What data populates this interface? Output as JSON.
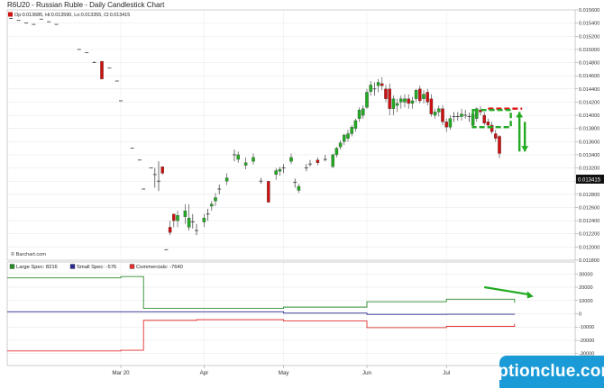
{
  "page_title": "R6U20 - Russian Ruble - Daily Candlestick Chart",
  "ohlc_label": "Op:0.013685, Hi:0.013590, Lo:0.013355, Cl:0.013415",
  "credit": "© Barchart.com",
  "last_price": "0.013415",
  "watermark": "optionclue.com",
  "colors": {
    "up": "#22aa22",
    "down": "#cc1111",
    "large_spec": "#2a8a2a",
    "small_spec": "#2a2a90",
    "commercials": "#e03030",
    "resistance": "#e01010",
    "box": "#22aa22",
    "price_box": "#111111"
  },
  "chart_data": [
    {
      "type": "candlestick",
      "title": "R6U20 - Russian Ruble - Daily Candlestick Chart",
      "ylim": [
        0.0118,
        0.0156
      ],
      "yticks": [
        "0.015600",
        "0.015400",
        "0.015200",
        "0.015000",
        "0.014800",
        "0.014600",
        "0.014400",
        "0.014200",
        "0.014000",
        "0.013800",
        "0.013600",
        "0.013400",
        "0.013200",
        "0.013000",
        "0.012800",
        "0.012600",
        "0.012400",
        "0.012200",
        "0.012000",
        "0.011800"
      ],
      "xticks": [
        "Mar 20",
        "Apr",
        "May",
        "Jun",
        "Jul"
      ],
      "xtick_days": [
        30,
        52,
        73,
        95,
        116
      ],
      "xlim_days": [
        0,
        150
      ],
      "candles": [
        [
          1,
          0.01547,
          0.01547,
          0.01547,
          0.01547
        ],
        [
          3,
          0.01544,
          0.01544,
          0.01544,
          0.01544
        ],
        [
          5,
          0.0154,
          0.0154,
          0.0154,
          0.0154
        ],
        [
          7,
          0.01538,
          0.01538,
          0.01538,
          0.01538
        ],
        [
          9,
          0.01546,
          0.01546,
          0.01546,
          0.01546
        ],
        [
          11,
          0.01542,
          0.01542,
          0.01542,
          0.01542
        ],
        [
          13,
          0.01538,
          0.01538,
          0.01538,
          0.01538
        ],
        [
          19,
          0.015,
          0.015,
          0.015,
          0.015
        ],
        [
          21,
          0.01495,
          0.01495,
          0.01495,
          0.01495
        ],
        [
          23,
          0.01482,
          0.01482,
          0.0148,
          0.0148
        ],
        [
          25,
          0.01482,
          0.01482,
          0.01455,
          0.01455
        ],
        [
          27,
          0.01472,
          0.01472,
          0.01472,
          0.01472
        ],
        [
          29,
          0.01452,
          0.01452,
          0.01452,
          0.01452
        ],
        [
          30,
          0.01422,
          0.01422,
          0.01422,
          0.01422
        ],
        [
          33,
          0.0135,
          0.0135,
          0.0135,
          0.0135
        ],
        [
          35,
          0.01332,
          0.01332,
          0.01332,
          0.01332
        ],
        [
          36,
          0.01288,
          0.01288,
          0.01288,
          0.01288
        ],
        [
          38,
          0.0132,
          0.0132,
          0.0132,
          0.0132
        ],
        [
          39,
          0.01312,
          0.0132,
          0.0129,
          0.0131
        ],
        [
          40,
          0.013,
          0.0133,
          0.01285,
          0.013
        ],
        [
          41,
          0.01322,
          0.01322,
          0.0131,
          0.01312
        ],
        [
          42,
          0.01196,
          0.01196,
          0.01196,
          0.01196
        ],
        [
          43,
          0.0123,
          0.0124,
          0.01218,
          0.01222
        ],
        [
          44,
          0.0125,
          0.0125,
          0.0123,
          0.0124
        ],
        [
          45,
          0.0124,
          0.01255,
          0.0123,
          0.01248
        ],
        [
          47,
          0.01246,
          0.01265,
          0.01235,
          0.01255
        ],
        [
          48,
          0.0123,
          0.01265,
          0.01225,
          0.01244
        ],
        [
          49,
          0.0124,
          0.0125,
          0.01228,
          0.01238
        ],
        [
          50,
          0.01225,
          0.01235,
          0.01218,
          0.01225
        ],
        [
          52,
          0.01238,
          0.0125,
          0.0123,
          0.01244
        ],
        [
          53,
          0.0125,
          0.01258,
          0.0124,
          0.0125
        ],
        [
          54,
          0.01262,
          0.0127,
          0.01255,
          0.01265
        ],
        [
          55,
          0.0127,
          0.01282,
          0.01262,
          0.01275
        ],
        [
          56,
          0.0129,
          0.01295,
          0.0128,
          0.01288
        ],
        [
          58,
          0.013,
          0.01312,
          0.01294,
          0.01305
        ],
        [
          60,
          0.01338,
          0.01348,
          0.0133,
          0.0134
        ],
        [
          61,
          0.01333,
          0.01345,
          0.01328,
          0.0134
        ],
        [
          63,
          0.01324,
          0.01336,
          0.01318,
          0.01328
        ],
        [
          65,
          0.0133,
          0.01342,
          0.01325,
          0.01336
        ],
        [
          67,
          0.013,
          0.01305,
          0.01296,
          0.013
        ],
        [
          69,
          0.013,
          0.013,
          0.01268,
          0.01268
        ],
        [
          71,
          0.0131,
          0.0132,
          0.01302,
          0.01316
        ],
        [
          72,
          0.01315,
          0.01322,
          0.01308,
          0.01318
        ],
        [
          73,
          0.01318,
          0.01326,
          0.01312,
          0.0132
        ],
        [
          75,
          0.0133,
          0.01342,
          0.01326,
          0.01336
        ],
        [
          76,
          0.01296,
          0.01304,
          0.0129,
          0.01298
        ],
        [
          77,
          0.01286,
          0.01296,
          0.01282,
          0.01292
        ],
        [
          79,
          0.0132,
          0.01326,
          0.01315,
          0.0132
        ],
        [
          80,
          0.01328,
          0.01332,
          0.01322,
          0.01326
        ],
        [
          82,
          0.01332,
          0.01336,
          0.01324,
          0.01328
        ],
        [
          84,
          0.01335,
          0.0134,
          0.0133,
          0.01333
        ],
        [
          86,
          0.01322,
          0.01342,
          0.0132,
          0.0134
        ],
        [
          87,
          0.0134,
          0.01352,
          0.01336,
          0.0135
        ],
        [
          88,
          0.01352,
          0.01362,
          0.01348,
          0.01358
        ],
        [
          89,
          0.0136,
          0.01372,
          0.01355,
          0.0137
        ],
        [
          90,
          0.01365,
          0.01378,
          0.0136,
          0.01372
        ],
        [
          91,
          0.01372,
          0.01385,
          0.01368,
          0.01382
        ],
        [
          92,
          0.0138,
          0.01395,
          0.01375,
          0.01392
        ],
        [
          93,
          0.01395,
          0.01412,
          0.0139,
          0.01408
        ],
        [
          94,
          0.014,
          0.01415,
          0.01395,
          0.0141
        ],
        [
          95,
          0.01412,
          0.0144,
          0.0141,
          0.01435
        ],
        [
          96,
          0.01436,
          0.01452,
          0.0143,
          0.01446
        ],
        [
          97,
          0.0144,
          0.0145,
          0.0143,
          0.0144
        ],
        [
          98,
          0.01445,
          0.01455,
          0.01435,
          0.0145
        ],
        [
          99,
          0.01448,
          0.01458,
          0.01438,
          0.01445
        ],
        [
          100,
          0.0144,
          0.01446,
          0.0142,
          0.01425
        ],
        [
          101,
          0.0144,
          0.01448,
          0.014,
          0.0141
        ],
        [
          102,
          0.0141,
          0.0143,
          0.014,
          0.01425
        ],
        [
          103,
          0.01415,
          0.01425,
          0.01405,
          0.01418
        ],
        [
          104,
          0.0142,
          0.0143,
          0.0141,
          0.01425
        ],
        [
          105,
          0.0142,
          0.01432,
          0.01412,
          0.01425
        ],
        [
          106,
          0.01425,
          0.01432,
          0.0141,
          0.01418
        ],
        [
          107,
          0.01418,
          0.01428,
          0.0141,
          0.01422
        ],
        [
          108,
          0.01425,
          0.0144,
          0.0142,
          0.01438
        ],
        [
          109,
          0.0144,
          0.01445,
          0.01418,
          0.01422
        ],
        [
          110,
          0.01425,
          0.01438,
          0.01418,
          0.01432
        ],
        [
          111,
          0.01435,
          0.0144,
          0.01415,
          0.0142
        ],
        [
          112,
          0.01425,
          0.01432,
          0.01398,
          0.01402
        ],
        [
          113,
          0.014,
          0.0141,
          0.01395,
          0.01405
        ],
        [
          114,
          0.01405,
          0.01415,
          0.01398,
          0.0141
        ],
        [
          115,
          0.0141,
          0.01415,
          0.01385,
          0.0139
        ],
        [
          116,
          0.0139,
          0.01395,
          0.01375,
          0.01382
        ],
        [
          117,
          0.01382,
          0.014,
          0.01378,
          0.01395
        ],
        [
          118,
          0.01395,
          0.01405,
          0.0139,
          0.01398
        ],
        [
          119,
          0.014,
          0.01405,
          0.01392,
          0.01398
        ],
        [
          120,
          0.01398,
          0.0141,
          0.01392,
          0.01402
        ],
        [
          121,
          0.01402,
          0.01408,
          0.01395,
          0.014
        ],
        [
          122,
          0.01396,
          0.01404,
          0.0139,
          0.01398
        ],
        [
          123,
          0.01385,
          0.01408,
          0.0138,
          0.01402
        ],
        [
          124,
          0.01395,
          0.01412,
          0.0139,
          0.0141
        ],
        [
          125,
          0.01408,
          0.01414,
          0.014,
          0.01405
        ],
        [
          126,
          0.014,
          0.01405,
          0.01385,
          0.01388
        ],
        [
          127,
          0.0139,
          0.01395,
          0.0138,
          0.01385
        ],
        [
          128,
          0.01385,
          0.0139,
          0.01372,
          0.01375
        ],
        [
          129,
          0.01372,
          0.01378,
          0.0136,
          0.01365
        ],
        [
          130,
          0.01368,
          0.0137,
          0.01335,
          0.01342
        ]
      ],
      "annotations": {
        "resistance_line": {
          "from_day": 127,
          "to_day": 136,
          "price": 0.0141
        },
        "box_top": 0.01408,
        "box_bottom": 0.01382,
        "box_from_day": 123,
        "box_to_day": 133,
        "arrow_day": 136,
        "arrow_up": [
          0.01345,
          0.01405
        ],
        "arrow_down": [
          0.0139,
          0.01345
        ]
      }
    },
    {
      "type": "line",
      "title": "Commitment of Traders",
      "ylim": [
        -39000,
        39000
      ],
      "yticks": [
        "30000",
        "20000",
        "10000",
        "0",
        "-10000",
        "-20000",
        "-30000"
      ],
      "ytick_values": [
        30000,
        20000,
        10000,
        0,
        -10000,
        -20000,
        -30000
      ],
      "legend": [
        "Large Spec: 8216",
        "Small Spec: -576",
        "Commercials: -7640"
      ],
      "series": [
        {
          "name": "Large Spec",
          "steps": [
            [
              0,
              27000
            ],
            [
              23,
              27000
            ],
            [
              30,
              28000
            ],
            [
              36,
              28000
            ],
            [
              36,
              4000
            ],
            [
              73,
              5000
            ],
            [
              95,
              9000
            ],
            [
              116,
              11000
            ],
            [
              134,
              8216
            ]
          ]
        },
        {
          "name": "Small Spec",
          "steps": [
            [
              0,
              1500
            ],
            [
              36,
              1500
            ],
            [
              73,
              500
            ],
            [
              95,
              -500
            ],
            [
              116,
              -400
            ],
            [
              134,
              -576
            ]
          ]
        },
        {
          "name": "Commercials",
          "steps": [
            [
              0,
              -28000
            ],
            [
              30,
              -27500
            ],
            [
              36,
              -27500
            ],
            [
              36,
              -5000
            ],
            [
              50,
              -4500
            ],
            [
              73,
              -5500
            ],
            [
              95,
              -10500
            ],
            [
              116,
              -9500
            ],
            [
              134,
              -7640
            ]
          ]
        }
      ],
      "arrow": {
        "from_day": 126,
        "to_day": 139,
        "from_value": 20000,
        "to_value": 13000
      }
    }
  ]
}
